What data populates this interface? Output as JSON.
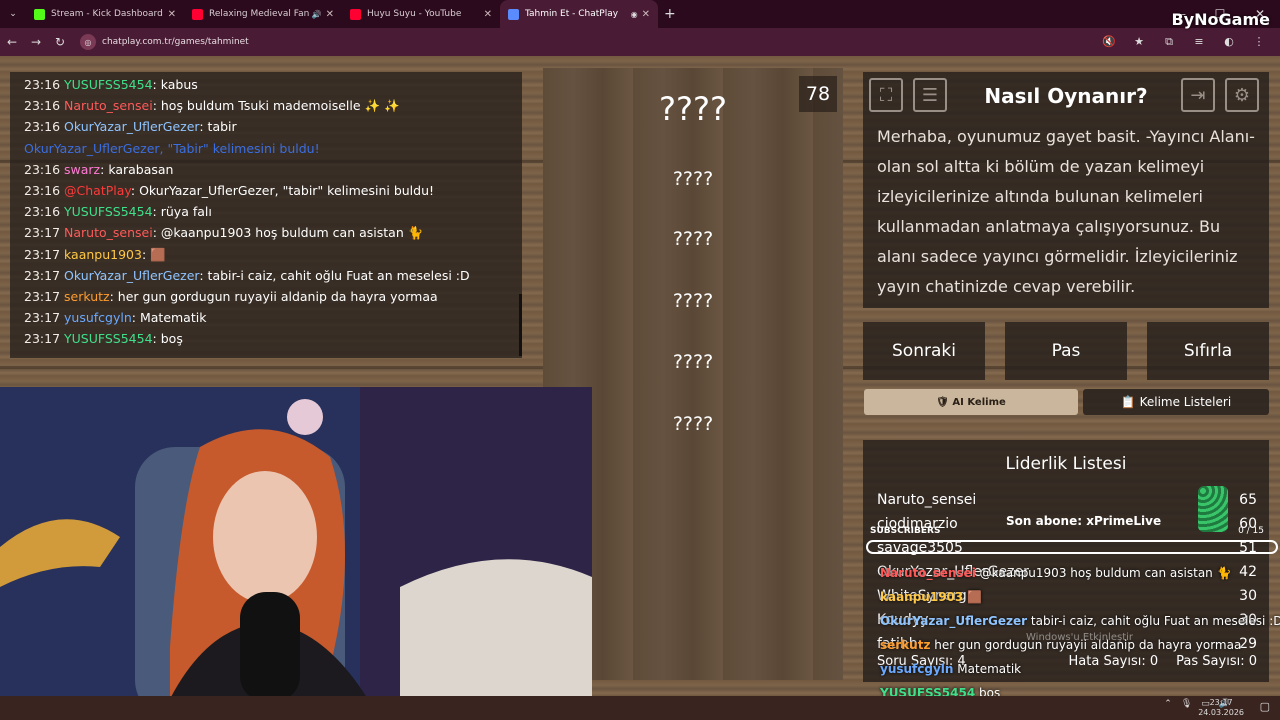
{
  "tabs": [
    {
      "title": "Stream - Kick Dashboard",
      "favicon_color": "#53fc18",
      "active": false
    },
    {
      "title": "Relaxing Medieval Fantasy M",
      "favicon_color": "#ff0033",
      "active": false
    },
    {
      "title": "Huyu Suyu - YouTube",
      "favicon_color": "#ff0033",
      "active": false
    },
    {
      "title": "Tahmin Et - ChatPlay",
      "favicon_color": "#5b8cff",
      "active": true
    }
  ],
  "address": {
    "url": "chatplay.com.tr/games/tahminet"
  },
  "chat": {
    "messages": [
      {
        "time": "23:16",
        "user": "YUSUFSS5454",
        "color": "#3fe08a",
        "text": "kabus"
      },
      {
        "time": "23:16",
        "user": "Naruto_sensei",
        "color": "#ff5a5a",
        "text": "hoş buldum Tsuki mademoiselle ✨ ✨"
      },
      {
        "time": "23:16",
        "user": "OkurYazar_UflerGezer",
        "color": "#8fc4ff",
        "text": "tabir"
      },
      {
        "time": "",
        "user": "OkurYazar_UflerGezer, \"Tabir\" kelimesini buldu!",
        "color": "#3b6ee0",
        "text": ""
      },
      {
        "time": "23:16",
        "user": "swarz",
        "color": "#ff7bd5",
        "text": "karabasan"
      },
      {
        "time": "23:16",
        "user": "@ChatPlay",
        "color": "#ff3b3b",
        "text": "OkurYazar_UflerGezer, \"tabir\" kelimesini buldu!"
      },
      {
        "time": "23:16",
        "user": "YUSUFSS5454",
        "color": "#3fe08a",
        "text": "rüya falı"
      },
      {
        "time": "23:17",
        "user": "Naruto_sensei",
        "color": "#ff5a5a",
        "text": "@kaanpu1903 hoş buldum can asistan 🐈"
      },
      {
        "time": "23:17",
        "user": "kaanpu1903",
        "color": "#ffc845",
        "text": "🟫"
      },
      {
        "time": "23:17",
        "user": "OkurYazar_UflerGezer",
        "color": "#8fc4ff",
        "text": "tabir-i caiz, cahit oğlu Fuat an meselesi :D"
      },
      {
        "time": "23:17",
        "user": "serkutz",
        "color": "#ff9d2e",
        "text": "her gun gordugun ruyayii aldanip da hayra yormaa"
      },
      {
        "time": "23:17",
        "user": "yusufcgyln",
        "color": "#6aa9ff",
        "text": "Matematik"
      },
      {
        "time": "23:17",
        "user": "YUSUFSS5454",
        "color": "#3fe08a",
        "text": "boş"
      }
    ]
  },
  "game": {
    "counter": "78",
    "words": [
      "????",
      "????",
      "????",
      "????",
      "????",
      "????"
    ]
  },
  "info": {
    "title": "Nasıl Oynanır?",
    "description": "Merhaba, oyunumuz gayet basit. -Yayıncı Alanı- olan sol altta ki bölüm de yazan kelimeyi izleyicilerinize altında bulunan kelimeleri kullanmadan anlatmaya çalışıyorsunuz. Bu alanı sadece yayıncı görmelidir. İzleyicileriniz yayın chatinizde cevap verebilir."
  },
  "actions": {
    "next": "Sonraki",
    "pass": "Pas",
    "reset": "Sıfırla",
    "ai_word": "🛡 AI Kelime",
    "word_lists": "📋 Kelime Listeleri"
  },
  "leaderboard": {
    "title": "Liderlik Listesi",
    "rows": [
      {
        "name": "Naruto_sensei",
        "score": "65"
      },
      {
        "name": "ciodimarzio",
        "score": "60"
      },
      {
        "name": "savage3505",
        "score": "51"
      },
      {
        "name": "OkurYazar_UflerGezer",
        "score": "42"
      },
      {
        "name": "WhiteSynerg",
        "score": "30"
      },
      {
        "name": "Koudyy",
        "score": "30"
      },
      {
        "name": "fatihb",
        "score": "29"
      }
    ],
    "question_count": "Soru Sayısı: 4",
    "error_count": "Hata Sayısı: 0",
    "pass_count": "Pas Sayısı: 0"
  },
  "overlay": {
    "brand": "ByNoGame",
    "subscribers_label": "SUBSCRIBERS",
    "subscribers_count": "0 / 15",
    "last_sub": "Son abone: xPrimeLive",
    "chat": [
      {
        "user": "Naruto_sensei",
        "color": "#ff5a5a",
        "text": "@kaanpu1903 hoş buldum can asistan 🐈"
      },
      {
        "user": "kaanpu1903",
        "color": "#ffc845",
        "text": "🟫"
      },
      {
        "user": "OkurYazar_UflerGezer",
        "color": "#8fc4ff",
        "text": "tabir-i caiz, cahit oğlu Fuat an meselesi :D"
      },
      {
        "user": "serkutz",
        "color": "#ff9d2e",
        "text": "her gun gordugun ruyayii aldanip da hayra yormaa"
      },
      {
        "user": "yusufcgyln",
        "color": "#6aa9ff",
        "text": "Matematik"
      },
      {
        "user": "YUSUFSS5454",
        "color": "#3fe08a",
        "text": "boş"
      }
    ],
    "watermark": "Windows'u Etkinleştir"
  },
  "taskbar": {
    "time": "23:17",
    "date": "24.03.2026"
  }
}
